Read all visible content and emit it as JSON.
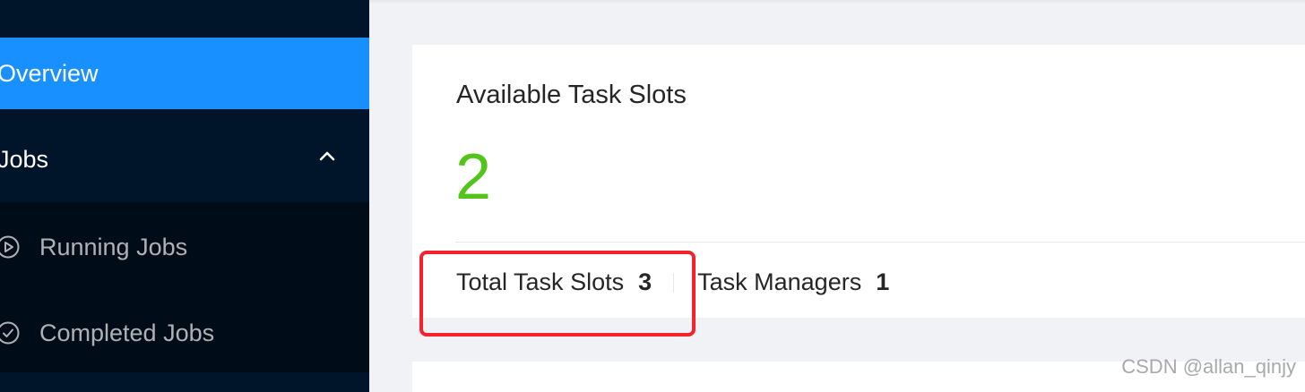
{
  "sidebar": {
    "overview_label": "Overview",
    "jobs_label": "Jobs",
    "jobs_submenu": [
      {
        "label": "Running Jobs"
      },
      {
        "label": "Completed Jobs"
      }
    ]
  },
  "card": {
    "title": "Available Task Slots",
    "value": "2",
    "total_task_slots_label": "Total Task Slots",
    "total_task_slots_value": "3",
    "task_managers_label": "Task Managers",
    "task_managers_value": "1"
  },
  "watermark": "CSDN @allan_qinjy",
  "colors": {
    "sidebar_bg": "#001529",
    "submenu_bg": "#000c17",
    "active_item": "#1890ff",
    "value_green": "#52c41a",
    "highlight_red": "#f5222d"
  }
}
